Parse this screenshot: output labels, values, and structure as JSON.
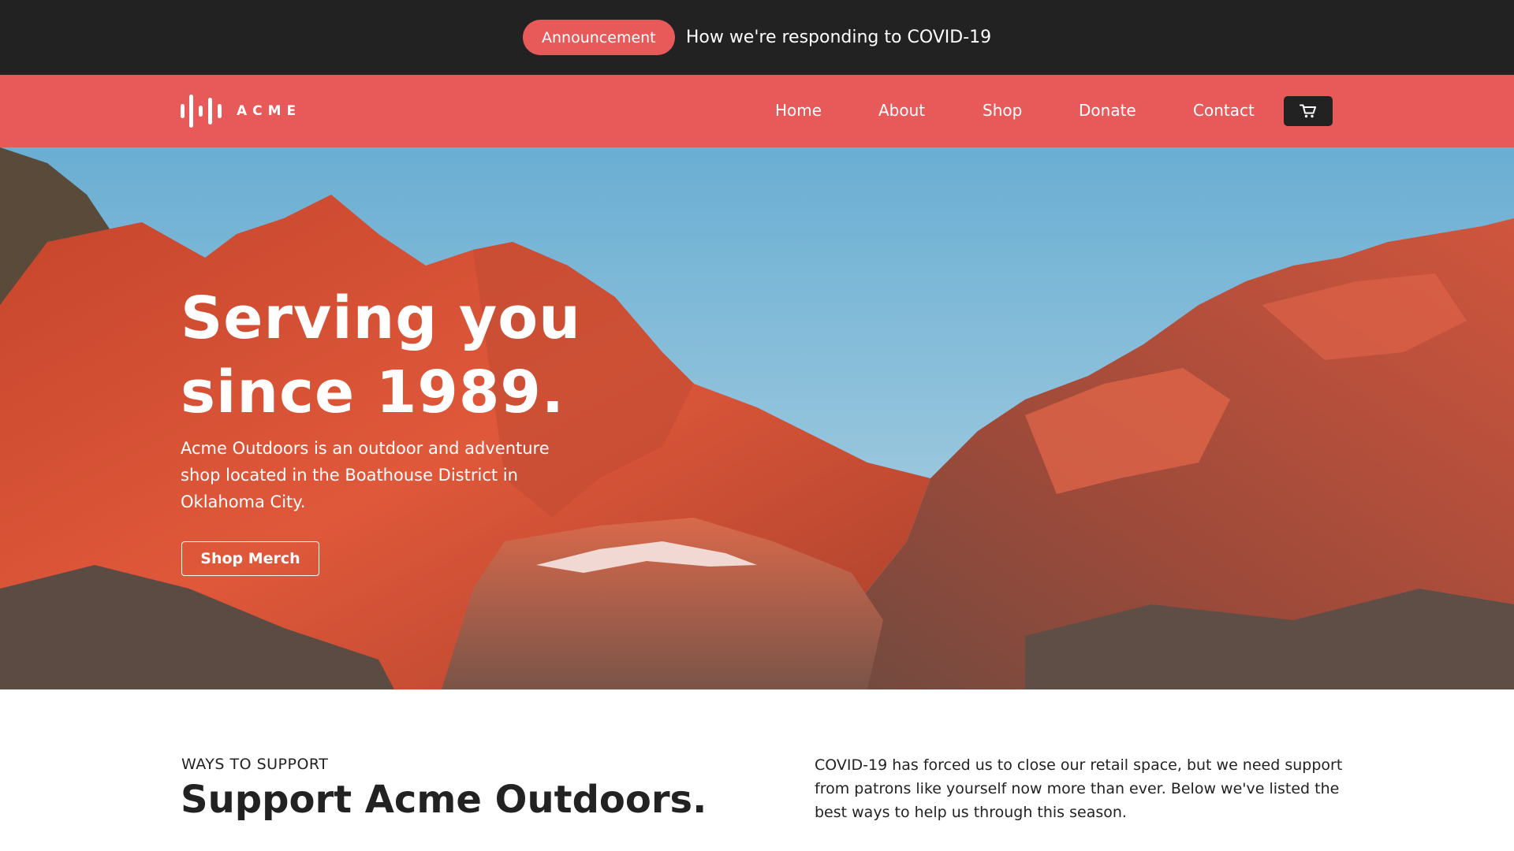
{
  "announcement": {
    "badge": "Announcement",
    "text": "How we're responding to COVID-19"
  },
  "nav": {
    "logo_text": "ACME",
    "links": [
      "Home",
      "About",
      "Shop",
      "Donate",
      "Contact"
    ],
    "cart_icon": "cart-icon"
  },
  "hero": {
    "title": "Serving you since 1989.",
    "subtitle": "Acme Outdoors is an outdoor and adventure shop located in the Boathouse District in Oklahoma City.",
    "button": "Shop Merch"
  },
  "support": {
    "eyebrow": "WAYS TO SUPPORT",
    "title": "Support Acme Outdoors.",
    "body": "COVID-19 has forced us to close our retail space, but we need support from patrons like yourself now more than ever. Below we've listed the best ways to help us through this season."
  },
  "colors": {
    "accent": "#e85a5a",
    "dark": "#222222",
    "white": "#ffffff"
  }
}
